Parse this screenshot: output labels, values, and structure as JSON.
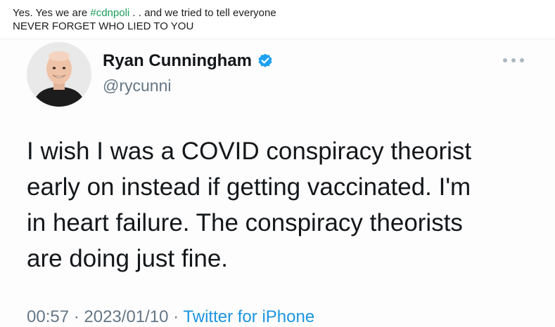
{
  "caption": {
    "line1_prefix": "Yes. Yes we are ",
    "hashtag": "#cdnpoli",
    "line1_suffix": " . . and we tried to tell everyone",
    "line2": "NEVER FORGET WHO LIED TO YOU"
  },
  "tweet": {
    "display_name": "Ryan Cunningham",
    "handle": "@rycunni",
    "verified_icon": "verified-badge-icon",
    "more_icon": "more-options-icon",
    "avatar_icon": "user-avatar",
    "text": "I wish I was a COVID conspiracy theorist\nearly on instead if getting vaccinated.  I'm\nin heart failure.  The conspiracy theorists\nare doing just fine.",
    "time": "00:57",
    "separator": " · ",
    "date": "2023/01/10",
    "source": "Twitter for iPhone"
  },
  "colors": {
    "hashtag": "#1a9e5a",
    "verified": "#1da1f2",
    "link": "#1b95e0",
    "muted": "#657786"
  }
}
